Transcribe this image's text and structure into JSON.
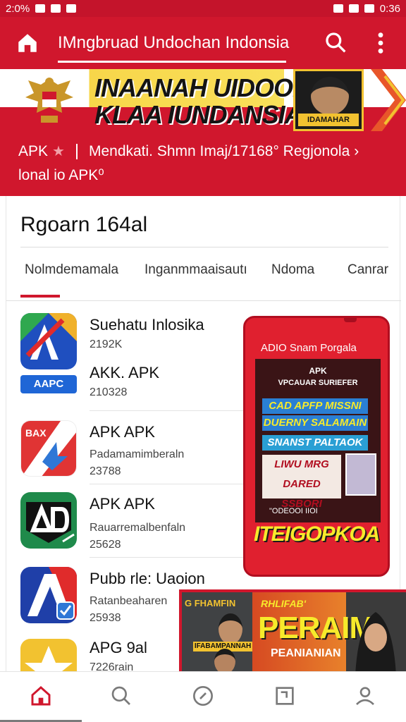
{
  "status_bar": {
    "time_left": "2:0%",
    "time_right": "0:36"
  },
  "app_bar": {
    "title": "IMngbruad Undochan Indonsia"
  },
  "banner": {
    "headline_line1": "INAANAH UIDOONAN",
    "headline_line2": "KLAA IUNDANSIA",
    "card_label": "IDAMAHAR"
  },
  "info_strip": {
    "apk_label": "APK",
    "text": "Mendkati. Shmn Imaj/17168° Regjonola",
    "chevron": "›",
    "line2": "lonal io APK⁰"
  },
  "section": {
    "title": "Rgoarn 164al"
  },
  "tabs": [
    {
      "label": "Nolmdemamala"
    },
    {
      "label": "Inganmmaaisautı"
    },
    {
      "label": "Ndoma"
    },
    {
      "label": "Canrar"
    }
  ],
  "apps": [
    {
      "title": "Suehatu Inlosika",
      "line1": "2192K",
      "title2": "AKK. APK",
      "line2": "210328",
      "icon_badge": "AAPC"
    },
    {
      "title": "APK  APK",
      "line1": "Padamamimberaln",
      "line2": "23788",
      "icon_badge": "BAX"
    },
    {
      "title": "APK  APK",
      "line1": "Rauarremalbenfaln",
      "line2": "25628",
      "icon_badge": "AD"
    },
    {
      "title": "Pubb rle: Uaoion",
      "line1": "Ratanbeaharen",
      "line2": "25938",
      "icon_badge": "A"
    },
    {
      "title": "APG  9al",
      "line1": "7226rain",
      "line2": "",
      "icon_badge": "★"
    }
  ],
  "phone_ad": {
    "header": "ADIO Snam Porgala",
    "screen_line1": "APK",
    "screen_line2": "VPCAUAR SURIEFER",
    "ribbon1": "CAD APFP MISSNI",
    "ribbon2": "DUERNY SALAMAIN",
    "ribbon3": "SNANST PALTAOK",
    "promo": "LIWU MRG DARED SSBORI",
    "mini": "\"ODEOOI  IIOI",
    "cta": "ITEIGOPKOA"
  },
  "bottom_banner": {
    "left_top": "G FHAMFIN",
    "left_strip": "IFABAMPANNAH",
    "small": "RHLIFAB'",
    "big": "PERAIM",
    "sub": "PEANIANIAN"
  },
  "nav": {
    "items": [
      "home-icon",
      "search-icon",
      "compass-icon",
      "square-icon",
      "profile-icon"
    ]
  },
  "colors": {
    "brand_red": "#d0172d",
    "accent_yellow": "#f7ea2b"
  }
}
